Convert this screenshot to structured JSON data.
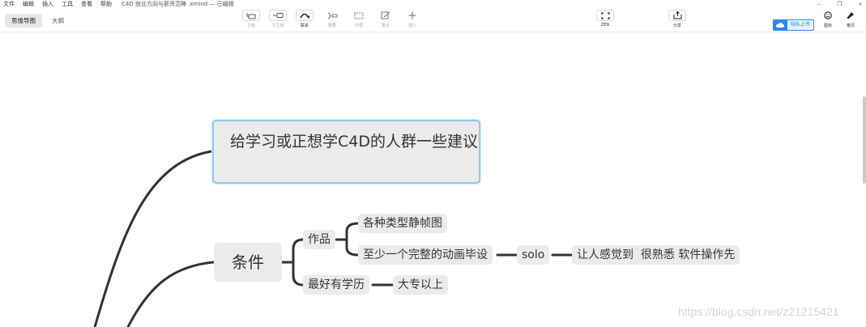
{
  "menubar": {
    "items": [
      "文件",
      "编辑",
      "插入",
      "工具",
      "查看",
      "帮助"
    ],
    "doc_title": "C4D 就业方向与薪资范畴 .xmind — 已编辑"
  },
  "window": {
    "minimize": "–",
    "restore": "❐",
    "close": "×"
  },
  "view_tabs": {
    "mindmap": "思维导图",
    "outline": "大纲"
  },
  "toolbar": {
    "topic": "主题",
    "subtopic": "子主题",
    "relation": "联系",
    "summary": "概要",
    "boundary": "外框",
    "note": "笔记",
    "insert": "插入",
    "zen": "ZEN",
    "share": "分享",
    "upload": "隐私上传",
    "icon": "图标",
    "format": "格式"
  },
  "map": {
    "main_topic": "给学习或正想学C4D的人群一些建议",
    "condition": "条件",
    "works": "作品",
    "still_frames": "各种类型静帧图",
    "animation": "至少一个完整的动画毕设",
    "solo": "solo",
    "familiar": "让人感觉到  很熟悉 软件操作先",
    "education": "最好有学历",
    "college": "大专以上"
  },
  "watermark": "https://blog.csdn.net/z21215421",
  "colors": {
    "accent": "#2b8bf2",
    "selection": "#8ccaf0",
    "node_bg": "#ebebeb",
    "connector": "#333333"
  }
}
